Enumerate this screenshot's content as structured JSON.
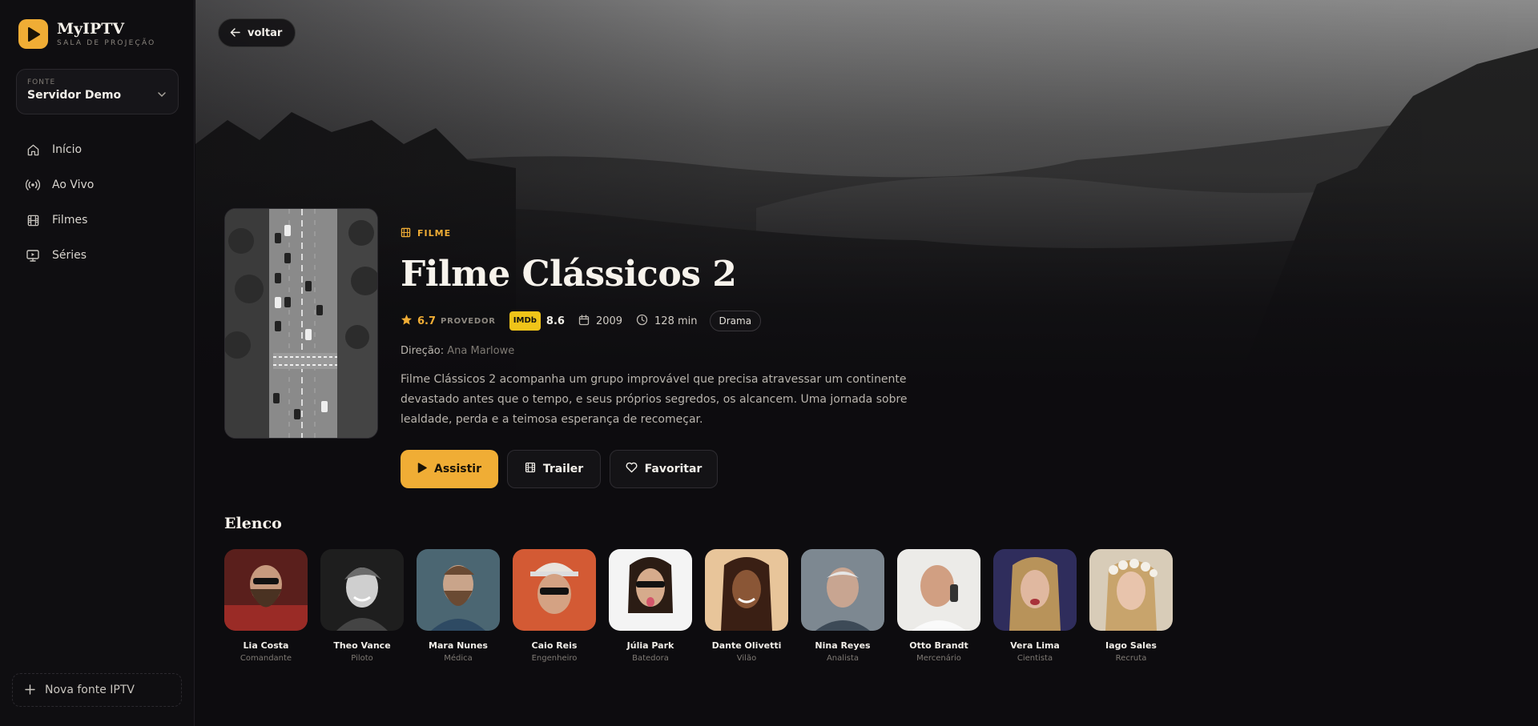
{
  "app": {
    "name": "MyIPTV",
    "tagline": "SALA DE PROJEÇÃO",
    "accent": "#f0ad35"
  },
  "source": {
    "label": "FONTE",
    "value": "Servidor Demo"
  },
  "nav": [
    {
      "label": "Início",
      "icon": "home-icon"
    },
    {
      "label": "Ao Vivo",
      "icon": "broadcast-icon"
    },
    {
      "label": "Filmes",
      "icon": "film-icon"
    },
    {
      "label": "Séries",
      "icon": "tv-icon"
    }
  ],
  "new_source": {
    "label": "Nova fonte IPTV"
  },
  "back": {
    "label": "voltar"
  },
  "movie": {
    "kind": "FILME",
    "title": "Filme Clássicos 2",
    "rating": "6.7",
    "rating_source": "PROVEDOR",
    "imdb_label": "IMDb",
    "imdb_rating": "8.6",
    "year": "2009",
    "duration": "128 min",
    "genre": "Drama",
    "director_label": "Direção:",
    "director": "Ana Marlowe",
    "synopsis": "Filme Clássicos 2 acompanha um grupo improvável que precisa atravessar um continente devastado antes que o tempo, e seus próprios segredos, os alcancem. Uma jornada sobre lealdade, perda e a teimosa esperança de recomeçar."
  },
  "actions": {
    "play": "Assistir",
    "trailer": "Trailer",
    "favorite": "Favoritar"
  },
  "cast": {
    "title": "Elenco",
    "members": [
      {
        "name": "Lia Costa",
        "role": "Comandante",
        "color": "#8a2f2a"
      },
      {
        "name": "Theo Vance",
        "role": "Piloto",
        "color": "#5a5a5a"
      },
      {
        "name": "Mara Nunes",
        "role": "Médica",
        "color": "#5b6f7a"
      },
      {
        "name": "Caio Reis",
        "role": "Engenheiro",
        "color": "#d9653a"
      },
      {
        "name": "Júlia Park",
        "role": "Batedora",
        "color": "#eeeeee"
      },
      {
        "name": "Dante Olivetti",
        "role": "Vilão",
        "color": "#c9904e"
      },
      {
        "name": "Nina Reyes",
        "role": "Analista",
        "color": "#8a95a0"
      },
      {
        "name": "Otto Brandt",
        "role": "Mercenário",
        "color": "#e8e6e3"
      },
      {
        "name": "Vera Lima",
        "role": "Cientista",
        "color": "#3c3a6a"
      },
      {
        "name": "Iago Sales",
        "role": "Recruta",
        "color": "#c9b9a3"
      }
    ]
  }
}
